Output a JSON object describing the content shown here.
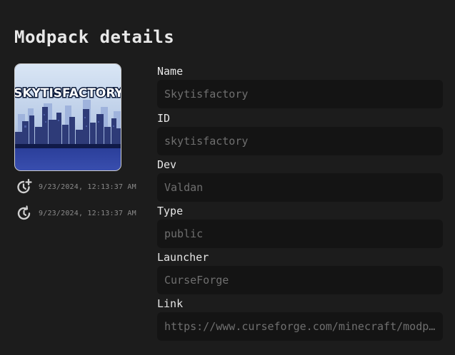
{
  "panel": {
    "title": "Modpack details"
  },
  "thumbnail": {
    "logo_text": "SKYTISFACTORY"
  },
  "meta": {
    "created": "9/23/2024, 12:13:37 AM",
    "updated": "9/23/2024, 12:13:37 AM",
    "created_icon": "clock-plus-icon",
    "updated_icon": "clock-refresh-icon"
  },
  "fields": {
    "name": {
      "label": "Name",
      "value": "Skytisfactory"
    },
    "id": {
      "label": "ID",
      "value": "skytisfactory"
    },
    "dev": {
      "label": "Dev",
      "value": "Valdan"
    },
    "type": {
      "label": "Type",
      "value": "public"
    },
    "launcher": {
      "label": "Launcher",
      "value": "CurseForge"
    },
    "link": {
      "label": "Link",
      "value": "https://www.curseforge.com/minecraft/modpacks/skytisfactory"
    }
  },
  "colors": {
    "background": "#1c1c1c",
    "field_background": "#141414",
    "label": "#e6e6e6",
    "value": "#6f6f6f",
    "muted": "#8a8a8a"
  }
}
